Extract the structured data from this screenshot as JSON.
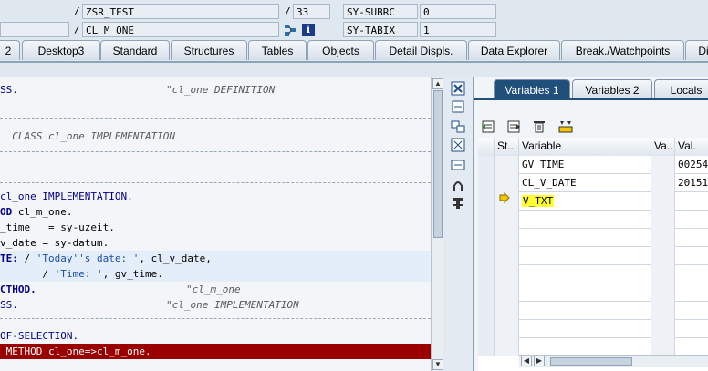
{
  "header": {
    "row1": {
      "program": "ZSR_TEST",
      "line": "33",
      "sysfield": "SY-SUBRC",
      "sysvalue": "0"
    },
    "row2": {
      "method": "CL_M_ONE",
      "sysfield": "SY-TABIX",
      "sysvalue": "1"
    },
    "slash": "/",
    "info_icon_label": "i"
  },
  "tabs": [
    "2",
    "Desktop3",
    "Standard",
    "Structures",
    "Tables",
    "Objects",
    "Detail Displs.",
    "Data Explorer",
    "Break./Watchpoints",
    "Di"
  ],
  "code": {
    "l1": "SS.",
    "l1_comment": "\"cl_one DEFINITION",
    "l2_comment": "  CLASS cl_one IMPLEMENTATION",
    "l3_kw": "cl_one IMPLEMENTATION.",
    "l4_kw": "OD",
    "l4_rest": " cl_m_one.",
    "l5": "_time   = sy-uzeit.",
    "l6": "v_date = sy-datum.",
    "l7_kw": "TE:",
    "l7_a": " / ",
    "l7_str": "'Today''s date: '",
    "l7_b": ", cl_v_date,",
    "l8_a": "       / ",
    "l8_str": "'Time: '",
    "l8_b": ", gv_time.",
    "l9_kw": "CTHOD.",
    "l9_comment": "\"cl_m_one",
    "l10": "SS.",
    "l10_comment": "\"cl_one IMPLEMENTATION",
    "l11_kw": "OF-SELECTION.",
    "l12": " METHOD cl_one=>cl_m_one."
  },
  "right_pane": {
    "tabs": [
      "Variables 1",
      "Variables 2",
      "Locals"
    ],
    "columns": {
      "status": "St..",
      "variable": "Variable",
      "va": "Va..",
      "val": "Val."
    },
    "rows": [
      {
        "variable": "GV_TIME",
        "val": "00254"
      },
      {
        "variable": "CL_V_DATE",
        "val": "20151"
      },
      {
        "variable": "V_TXT",
        "val": ""
      }
    ]
  }
}
